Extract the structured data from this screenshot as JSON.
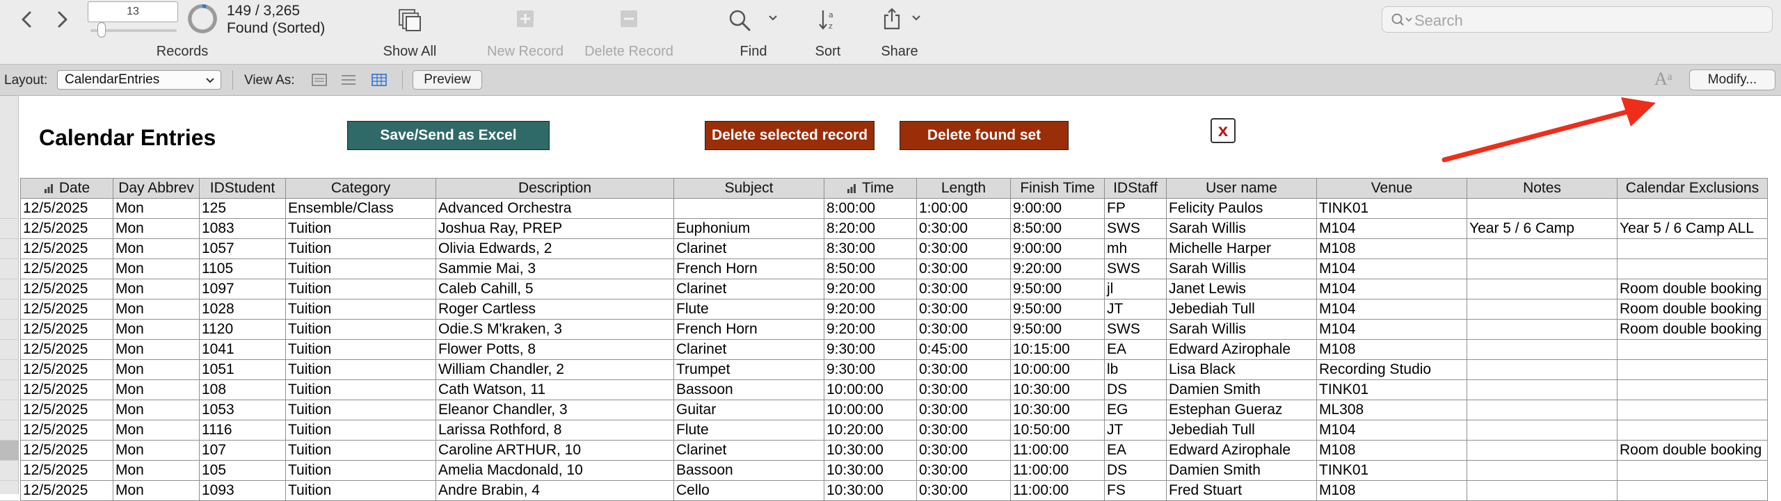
{
  "toolbar": {
    "record_number": "13",
    "found_count": "149 / 3,265",
    "found_status": "Found (Sorted)",
    "records_label": "Records",
    "show_all_label": "Show All",
    "new_record_label": "New Record",
    "delete_record_label": "Delete Record",
    "find_label": "Find",
    "sort_label": "Sort",
    "share_label": "Share",
    "search_placeholder": "Search",
    "found_fraction": 0.046
  },
  "layout_bar": {
    "layout_label": "Layout:",
    "layout_value": "CalendarEntries",
    "view_as_label": "View As:",
    "preview_label": "Preview",
    "modify_label": "Modify...",
    "format_icon": "Aᵃ"
  },
  "page": {
    "title": "Calendar Entries",
    "save_excel_label": "Save/Send as Excel",
    "delete_selected_label": "Delete selected record",
    "delete_found_label": "Delete found set",
    "close_label": "x"
  },
  "colors": {
    "save_excel": "#2f6a68",
    "delete_buttons": "#9a2e08",
    "annotation_arrow": "#ee2e1a",
    "view_as_active": "#2b6fd6"
  },
  "icons": [
    "chevron-left-icon",
    "chevron-right-icon",
    "show-all-icon",
    "plus-icon",
    "minus-icon",
    "magnifier-icon",
    "sort-az-icon",
    "share-icon",
    "search-icon",
    "chevron-down-icon",
    "view-form-icon",
    "view-list-icon",
    "view-table-icon",
    "format-text-icon",
    "close-icon",
    "sort-bars-icon"
  ],
  "table": {
    "columns": [
      "Date",
      "Day Abbrev",
      "IDStudent",
      "Category",
      "Description",
      "Subject",
      "Time",
      "Length",
      "Finish Time",
      "IDStaff",
      "User name",
      "Venue",
      "Notes",
      "Calendar Exclusions"
    ],
    "sorted_columns": [
      "Date",
      "Time"
    ],
    "rows": [
      [
        "12/5/2025",
        "Mon",
        "125",
        "Ensemble/Class",
        "Advanced Orchestra",
        "",
        "8:00:00",
        "1:00:00",
        "9:00:00",
        "FP",
        "Felicity Paulos",
        "TINK01",
        "",
        ""
      ],
      [
        "12/5/2025",
        "Mon",
        "1083",
        "Tuition",
        "Joshua Ray, PREP",
        "Euphonium",
        "8:20:00",
        "0:30:00",
        "8:50:00",
        "SWS",
        "Sarah Willis",
        "M104",
        "Year 5 / 6 Camp",
        "Year 5 / 6 Camp ALL"
      ],
      [
        "12/5/2025",
        "Mon",
        "1057",
        "Tuition",
        "Olivia Edwards, 2",
        "Clarinet",
        "8:30:00",
        "0:30:00",
        "9:00:00",
        "mh",
        "Michelle Harper",
        "M108",
        "",
        ""
      ],
      [
        "12/5/2025",
        "Mon",
        "1105",
        "Tuition",
        "Sammie Mai, 3",
        "French Horn",
        "8:50:00",
        "0:30:00",
        "9:20:00",
        "SWS",
        "Sarah Willis",
        "M104",
        "",
        ""
      ],
      [
        "12/5/2025",
        "Mon",
        "1097",
        "Tuition",
        "Caleb Cahill, 5",
        "Clarinet",
        "9:20:00",
        "0:30:00",
        "9:50:00",
        "jl",
        "Janet Lewis",
        "M104",
        "",
        "Room double booking"
      ],
      [
        "12/5/2025",
        "Mon",
        "1028",
        "Tuition",
        "Roger Cartless",
        "Flute",
        "9:20:00",
        "0:30:00",
        "9:50:00",
        "JT",
        "Jebediah Tull",
        "M104",
        "",
        "Room double booking"
      ],
      [
        "12/5/2025",
        "Mon",
        "1120",
        "Tuition",
        "Odie.S M'kraken, 3",
        "French Horn",
        "9:20:00",
        "0:30:00",
        "9:50:00",
        "SWS",
        "Sarah Willis",
        "M104",
        "",
        "Room double booking"
      ],
      [
        "12/5/2025",
        "Mon",
        "1041",
        "Tuition",
        "Flower Potts, 8",
        "Clarinet",
        "9:30:00",
        "0:45:00",
        "10:15:00",
        "EA",
        "Edward Azirophale",
        "M108",
        "",
        ""
      ],
      [
        "12/5/2025",
        "Mon",
        "1051",
        "Tuition",
        "William Chandler, 2",
        "Trumpet",
        "9:30:00",
        "0:30:00",
        "10:00:00",
        "lb",
        "Lisa Black",
        "Recording Studio",
        "",
        ""
      ],
      [
        "12/5/2025",
        "Mon",
        "108",
        "Tuition",
        "Cath Watson, 11",
        "Bassoon",
        "10:00:00",
        "0:30:00",
        "10:30:00",
        "DS",
        "Damien Smith",
        "TINK01",
        "",
        ""
      ],
      [
        "12/5/2025",
        "Mon",
        "1053",
        "Tuition",
        "Eleanor Chandler, 3",
        "Guitar",
        "10:00:00",
        "0:30:00",
        "10:30:00",
        "EG",
        "Estephan Gueraz",
        "ML308",
        "",
        ""
      ],
      [
        "12/5/2025",
        "Mon",
        "1116",
        "Tuition",
        "Larissa Rothford, 8",
        "Flute",
        "10:20:00",
        "0:30:00",
        "10:50:00",
        "JT",
        "Jebediah Tull",
        "M104",
        "",
        ""
      ],
      [
        "12/5/2025",
        "Mon",
        "107",
        "Tuition",
        "Caroline ARTHUR, 10",
        "Clarinet",
        "10:30:00",
        "0:30:00",
        "11:00:00",
        "EA",
        "Edward Azirophale",
        "M108",
        "",
        "Room double booking"
      ],
      [
        "12/5/2025",
        "Mon",
        "105",
        "Tuition",
        "Amelia Macdonald, 10",
        "Bassoon",
        "10:30:00",
        "0:30:00",
        "11:00:00",
        "DS",
        "Damien Smith",
        "TINK01",
        "",
        ""
      ],
      [
        "12/5/2025",
        "Mon",
        "1093",
        "Tuition",
        "Andre Brabin, 4",
        "Cello",
        "10:30:00",
        "0:30:00",
        "11:00:00",
        "FS",
        "Fred Stuart",
        "M108",
        "",
        ""
      ]
    ],
    "active_row_index": 12
  }
}
